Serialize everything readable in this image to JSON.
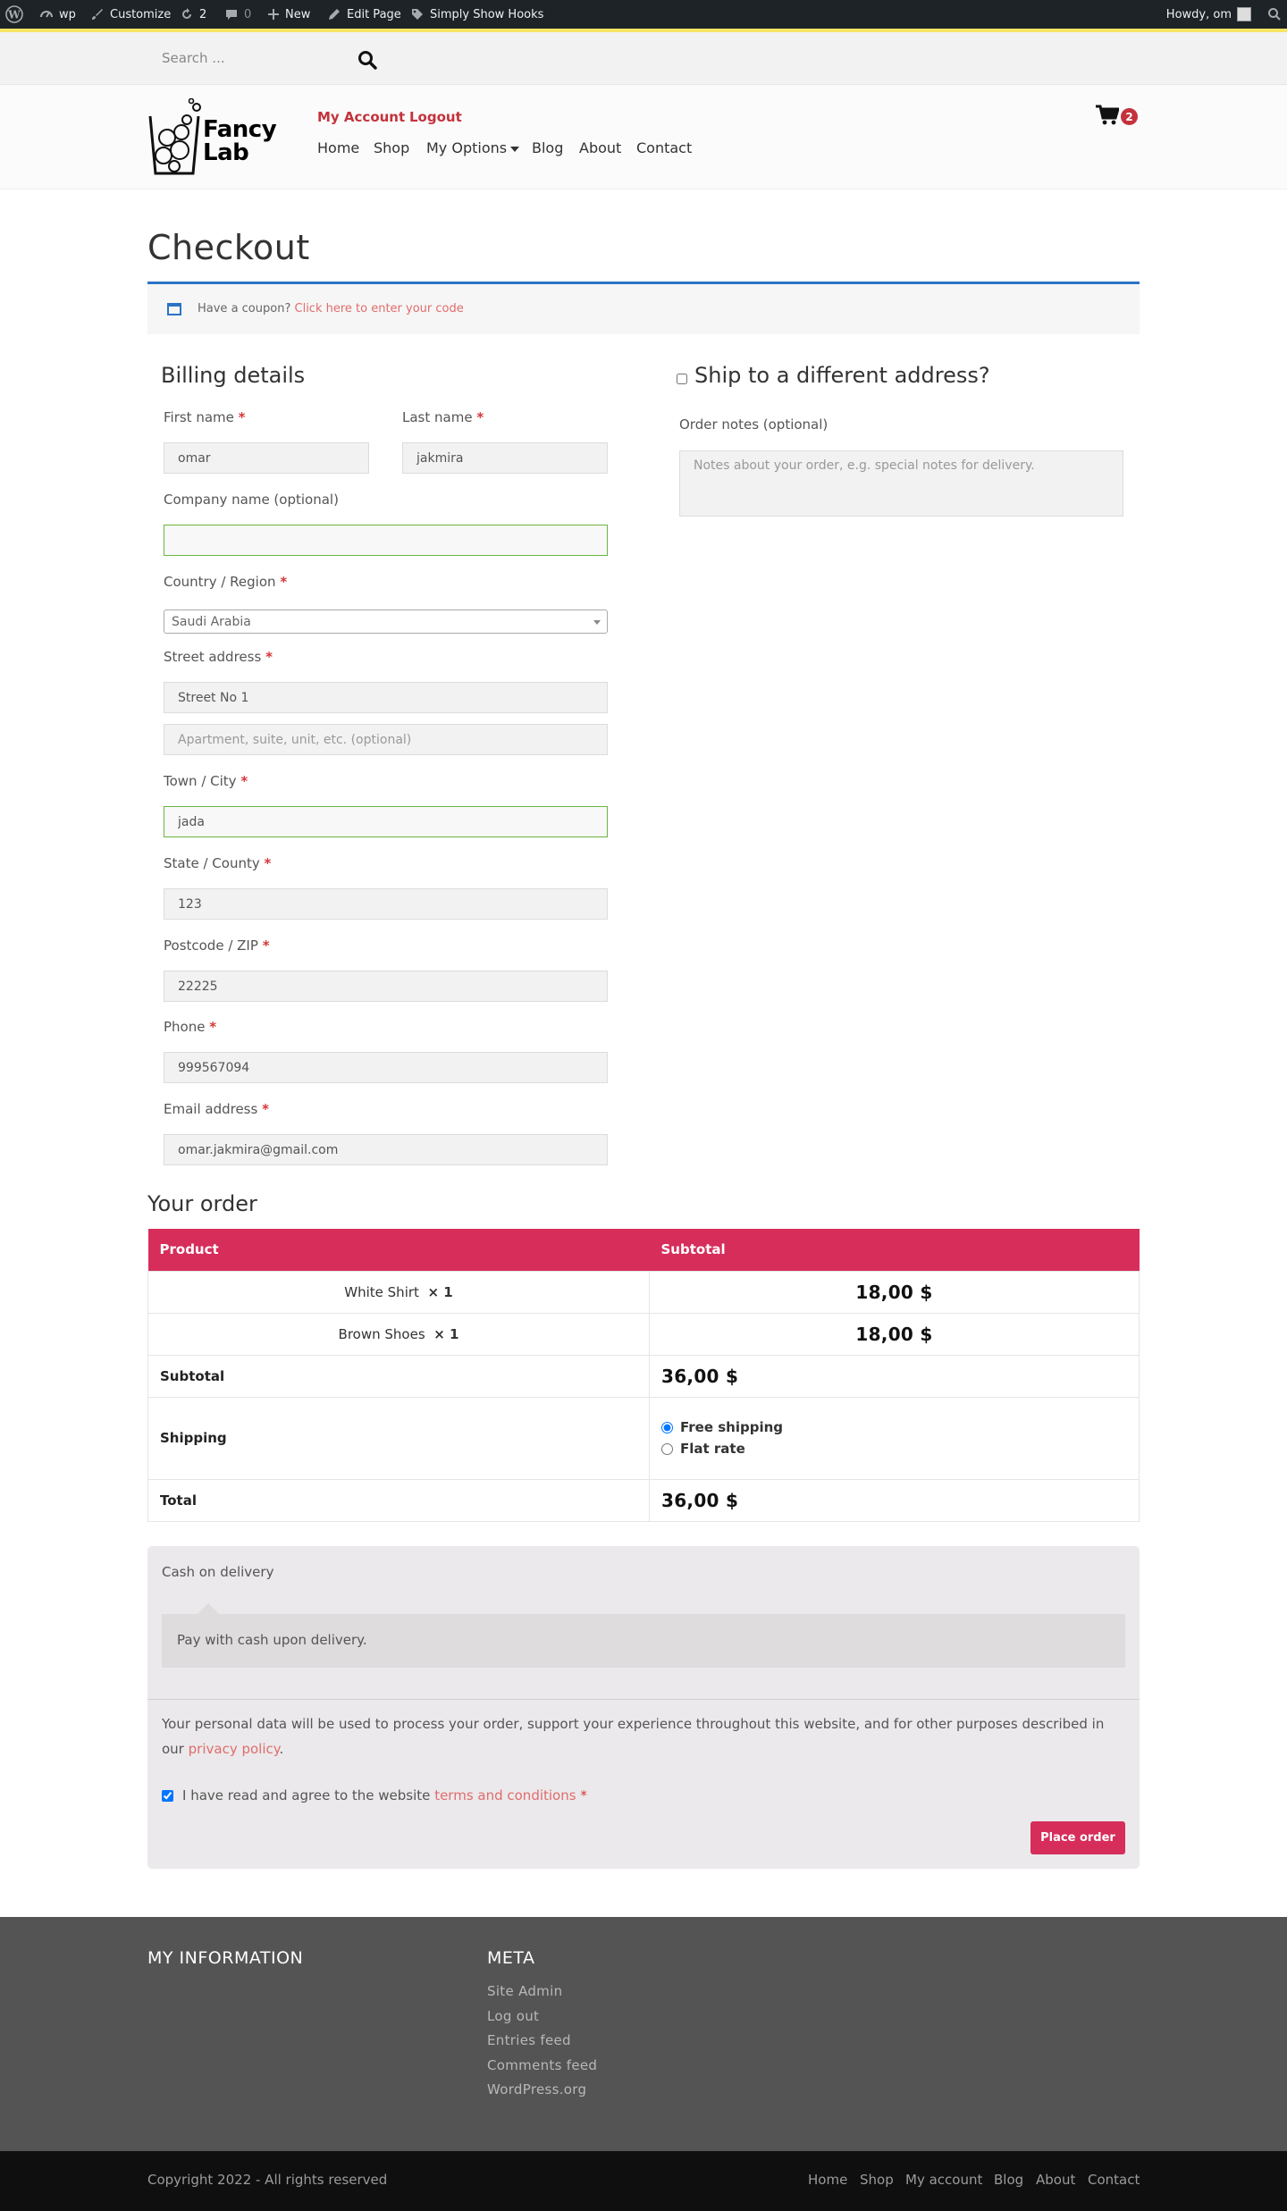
{
  "admin_bar": {
    "site": "wp",
    "customize": "Customize",
    "updates_count": "2",
    "comments_count": "0",
    "new": "New",
    "edit_page": "Edit Page",
    "plugin": "Simply Show Hooks",
    "howdy": "Howdy, om"
  },
  "search": {
    "placeholder": "Search ..."
  },
  "header": {
    "logo_line1": "Fancy",
    "logo_line2": "Lab",
    "my_account": "My Account",
    "logout": "Logout",
    "nav": [
      "Home",
      "Shop",
      "My Options",
      "Blog",
      "About",
      "Contact"
    ],
    "cart_count": "2"
  },
  "page": {
    "title": "Checkout",
    "coupon_prompt": "Have a coupon?",
    "coupon_link": "Click here to enter your code"
  },
  "billing": {
    "heading": "Billing details",
    "first_name_label": "First name",
    "first_name": "omar",
    "last_name_label": "Last name",
    "last_name": "jakmira",
    "company_label": "Company name (optional)",
    "company": "",
    "country_label": "Country / Region",
    "country": "Saudi Arabia",
    "street_label": "Street address",
    "street1": "Street No 1",
    "street2_placeholder": "Apartment, suite, unit, etc. (optional)",
    "city_label": "Town / City",
    "city": "jada",
    "state_label": "State / County",
    "state": "123",
    "postcode_label": "Postcode / ZIP",
    "postcode": "22225",
    "phone_label": "Phone",
    "phone": "999567094",
    "email_label": "Email address",
    "email": "omar.jakmira@gmail.com",
    "required_mark": "*"
  },
  "shipping": {
    "ship_different_label": "Ship to a different address?",
    "notes_label": "Order notes (optional)",
    "notes_placeholder": "Notes about your order, e.g. special notes for delivery."
  },
  "order": {
    "heading": "Your order",
    "col_product": "Product",
    "col_subtotal": "Subtotal",
    "items": [
      {
        "name": "White Shirt",
        "qty": "× 1",
        "subtotal": "18,00 $"
      },
      {
        "name": "Brown Shoes",
        "qty": "× 1",
        "subtotal": "18,00 $"
      }
    ],
    "subtotal_label": "Subtotal",
    "subtotal": "36,00 $",
    "shipping_label": "Shipping",
    "shipping_options": [
      "Free shipping",
      "Flat rate"
    ],
    "shipping_selected": "Free shipping",
    "total_label": "Total",
    "total": "36,00 $"
  },
  "payment": {
    "method": "Cash on delivery",
    "description": "Pay with cash upon delivery.",
    "privacy_text": "Your personal data will be used to process your order, support your experience throughout this website, and for other purposes described in our",
    "privacy_link": "privacy policy",
    "terms_text": "I have read and agree to the website",
    "terms_link": "terms and conditions",
    "place_order": "Place order"
  },
  "footer": {
    "col1_heading": "MY INFORMATION",
    "col2_heading": "META",
    "meta_links": [
      "Site Admin",
      "Log out",
      "Entries feed",
      "Comments feed",
      "WordPress.org"
    ],
    "copyright": "Copyright 2022 - All rights reserved",
    "bottom_links": [
      "Home",
      "Shop",
      "My account",
      "Blog",
      "About",
      "Contact"
    ]
  },
  "colors": {
    "accent": "#d62d5b",
    "link": "#c4323c",
    "coupon_border": "#2b74c5",
    "footer": "#545454"
  }
}
